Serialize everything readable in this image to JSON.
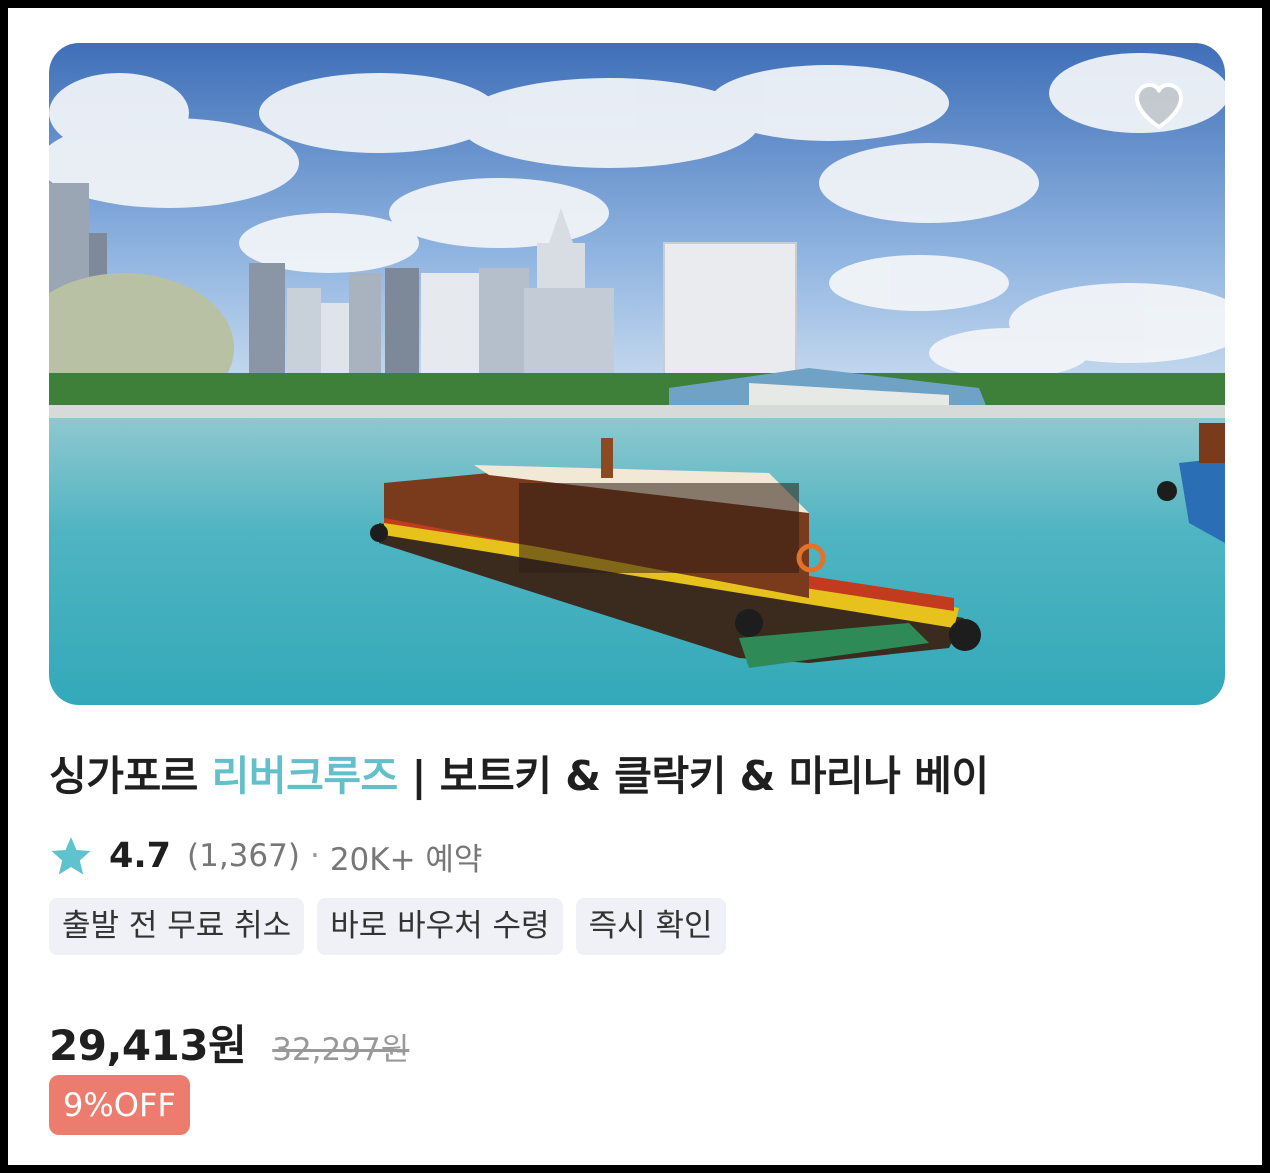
{
  "product": {
    "title_prefix": "싱가포르 ",
    "title_highlight": "리버크루즈",
    "title_suffix": " | 보트키 & 클락키 & 마리나 베이",
    "image_description_icon": "singapore-river-cruise-photo",
    "favorite_icon": "heart-outline-icon"
  },
  "rating": {
    "icon": "star-icon",
    "score": "4.7",
    "review_count": "(1,367)",
    "separator": "·",
    "bookings": "20K+ 예약"
  },
  "tags": [
    "출발 전 무료 취소",
    "바로 바우처 수령",
    "즉시 확인"
  ],
  "pricing": {
    "price": "29,413원",
    "original_price": "32,297원",
    "discount_badge": "9%OFF"
  },
  "colors": {
    "highlight": "#63bfc9",
    "star": "#5ec3cc",
    "discount_badge": "#ec7c6e",
    "tag_background": "#eff1f6"
  }
}
